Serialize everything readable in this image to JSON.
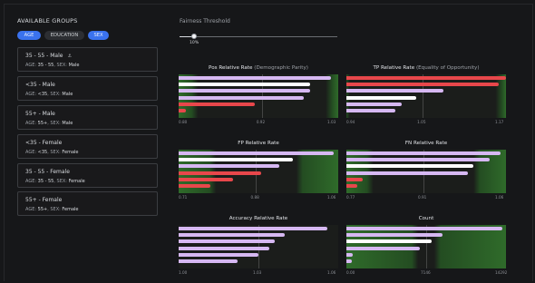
{
  "left_panel": {
    "title": "AVAILABLE GROUPS",
    "pills": [
      {
        "label": "AGE",
        "active": true
      },
      {
        "label": "EDUCATION",
        "active": false
      },
      {
        "label": "SEX",
        "active": true
      }
    ],
    "groups": [
      {
        "name": "35 - 55 - Male",
        "age": "35 - 55",
        "sex": "Male",
        "anchor": true,
        "anchor_icon": "anchor-icon"
      },
      {
        "name": "<35 - Male",
        "age": "<35",
        "sex": "Male"
      },
      {
        "name": "55+ - Male",
        "age": "55+",
        "sex": "Male"
      },
      {
        "name": "<35 - Female",
        "age": "<35",
        "sex": "Female"
      },
      {
        "name": "35 - 55 - Female",
        "age": "35 - 55",
        "sex": "Female"
      },
      {
        "name": "55+ - Female",
        "age": "55+",
        "sex": "Female"
      }
    ],
    "age_prefix": "AGE: ",
    "sex_prefix": ", SEX: "
  },
  "threshold": {
    "label": "Fairness Threshold",
    "value_label": "10%",
    "value": 0.1
  },
  "colors": {
    "lavender": "#d6b8f2",
    "white": "#ffffff",
    "red": "#e8474b",
    "fail_green": "#2f6b2a",
    "pass_dark": "#1b1d1b"
  },
  "chart_data": [
    {
      "type": "bar",
      "title": "Pos Relative Rate",
      "subtitle": "(Demographic Parity)",
      "xlim": [
        0.8,
        1.03
      ],
      "reference": 0.92,
      "ticks": [
        "0.80",
        "0.92",
        "1.03"
      ],
      "values": [
        1.02,
        0.99,
        0.99,
        0.98,
        0.91,
        0.81
      ],
      "bar_colors": [
        "lavender",
        "white",
        "lavender",
        "lavender",
        "red",
        "red"
      ]
    },
    {
      "type": "bar",
      "title": "TP Relative Rate",
      "subtitle": "(Equality of Opportunity)",
      "xlim": [
        0.94,
        1.17
      ],
      "reference": 1.05,
      "ticks": [
        "0.94",
        "1.05",
        "1.17"
      ],
      "values": [
        1.17,
        1.16,
        1.08,
        1.04,
        1.02,
        1.01
      ],
      "bar_colors": [
        "red",
        "red",
        "lavender",
        "white",
        "lavender",
        "lavender"
      ]
    },
    {
      "type": "bar",
      "title": "FP Relative Rate",
      "subtitle": "",
      "xlim": [
        0.71,
        1.06
      ],
      "reference": 0.88,
      "ticks": [
        "0.71",
        "0.88",
        "1.06"
      ],
      "values": [
        1.05,
        0.96,
        0.93,
        0.89,
        0.83,
        0.78
      ],
      "bar_colors": [
        "lavender",
        "white",
        "lavender",
        "red",
        "red",
        "red"
      ]
    },
    {
      "type": "bar",
      "title": "FN Relative Rate",
      "subtitle": "",
      "xlim": [
        0.77,
        1.06
      ],
      "reference": 0.91,
      "ticks": [
        "0.77",
        "0.91",
        "1.06"
      ],
      "values": [
        1.05,
        1.03,
        1.0,
        0.99,
        0.8,
        0.79
      ],
      "bar_colors": [
        "lavender",
        "lavender",
        "white",
        "lavender",
        "red",
        "red"
      ]
    },
    {
      "type": "bar",
      "title": "Accuracy Relative Rate",
      "subtitle": "",
      "xlim": [
        1.0,
        1.06
      ],
      "reference": 1.03,
      "ticks": [
        "1.00",
        "1.03",
        "1.06"
      ],
      "values": [
        1.056,
        1.04,
        1.036,
        1.034,
        1.03,
        1.022
      ],
      "bar_colors": [
        "lavender",
        "lavender",
        "lavender",
        "lavender",
        "lavender",
        "lavender"
      ]
    },
    {
      "type": "bar",
      "title": "Count",
      "subtitle": "",
      "xlim": [
        0,
        14292
      ],
      "reference": 7146,
      "ticks": [
        "0.00",
        "7146",
        "14292"
      ],
      "values": [
        14000,
        8600,
        7600,
        6600,
        600,
        500
      ],
      "bar_colors": [
        "lavender",
        "lavender",
        "white",
        "lavender",
        "lavender",
        "lavender"
      ]
    }
  ]
}
